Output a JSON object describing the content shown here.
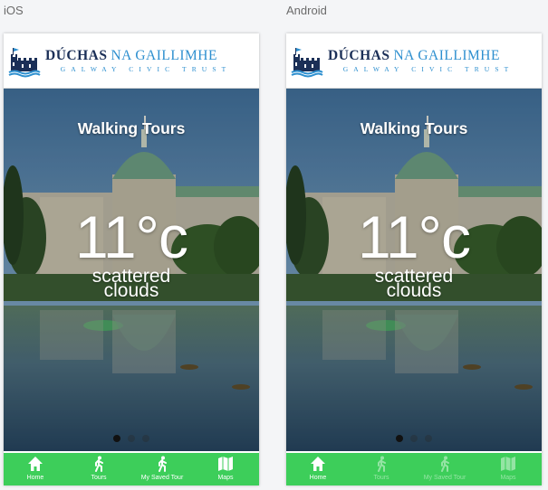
{
  "labels": {
    "ios": "iOS",
    "android": "Android"
  },
  "logo": {
    "title_part1": "DÚCHAS",
    "title_part2": "NA GAILLIMHE",
    "subtitle": "GALWAY CIVIC TRUST"
  },
  "hero": {
    "title": "Walking Tours",
    "temperature": "11°c",
    "condition_line1": "scattered",
    "condition_line2": "clouds"
  },
  "pager": {
    "total": 3,
    "active": 1
  },
  "tabs": [
    {
      "label": "Home",
      "icon": "home-icon"
    },
    {
      "label": "Tours",
      "icon": "walker-icon"
    },
    {
      "label": "My Saved Tour",
      "icon": "walker-icon"
    },
    {
      "label": "Maps",
      "icon": "map-icon"
    }
  ],
  "colors": {
    "tab_green": "#3dce5a",
    "brand_navy": "#1b2f57",
    "brand_blue": "#2d8fcf"
  }
}
